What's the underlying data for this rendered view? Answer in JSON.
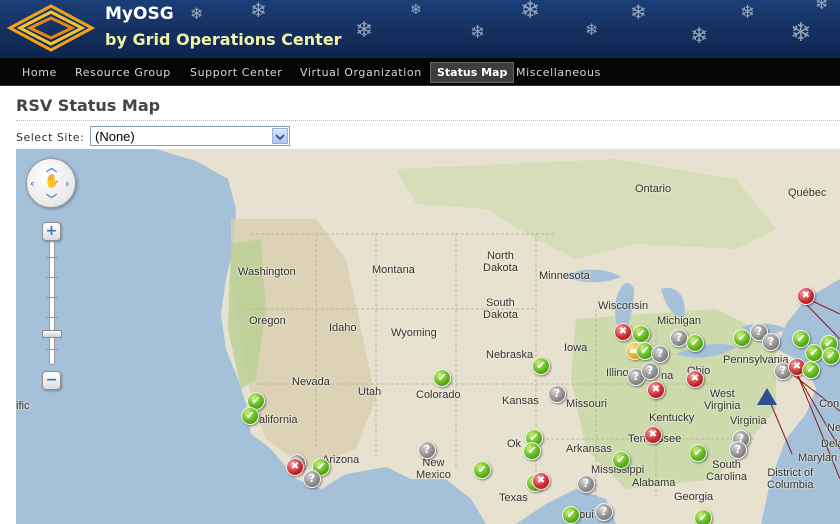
{
  "app": {
    "title": "MyOSG",
    "subtitle": "by Grid Operations Center",
    "logo_icon": "osg-logo-icon"
  },
  "nav": {
    "items": [
      {
        "label": "Home",
        "active": false
      },
      {
        "label": "Resource Group",
        "active": false
      },
      {
        "label": "Support Center",
        "active": false
      },
      {
        "label": "Virtual Organization",
        "active": false
      },
      {
        "label": "Status Map",
        "active": true
      },
      {
        "label": "Miscellaneous",
        "active": false
      }
    ]
  },
  "page": {
    "title": "RSV Status Map",
    "select_label": "Select Site:",
    "select_value": "(None)"
  },
  "map": {
    "controls": {
      "pan_icon": "hand-icon",
      "zoom_in": "+",
      "zoom_out": "−"
    },
    "labels": {
      "ontario": "Ontario",
      "quebec": "Québec",
      "washington": "Washington",
      "montana": "Montana",
      "north_dakota": "North\nDakota",
      "minnesota": "Minnesota",
      "south_dakota": "South\nDakota",
      "wisconsin": "Wisconsin",
      "michigan": "Michigan",
      "oregon": "Oregon",
      "idaho": "Idaho",
      "wyoming": "Wyoming",
      "nebraska": "Nebraska",
      "iowa": "Iowa",
      "pennsylvania": "Pennsylvania",
      "illinois": "Illino",
      "indiana": "na",
      "ohio": "Ohio",
      "nevada": "Nevada",
      "utah": "Utah",
      "colorado": "Colorado",
      "kansas": "Kansas",
      "missouri": "Missouri",
      "west_virginia": "West\nVirginia",
      "kentucky": "Kentucky",
      "virginia": "Virginia",
      "pacific": "ific",
      "california": "alifornia",
      "tennessee": "Tennessee",
      "oklahoma": "Ok",
      "arkansas": "Arkansas",
      "arizona": "Arizona",
      "new_mexico": "New\nMexico",
      "mississippi": "Mississippi",
      "south_carolina": "South\nCarolina",
      "north_carolina": "Ne",
      "delaware": "Dela",
      "maryland": "Marylan",
      "dc": "District of\nColumbia",
      "connecticut": "Con",
      "alabama": "Alabama",
      "georgia": "Georgia",
      "texas": "Texas",
      "louisiana": "Loui"
    },
    "markers": [
      {
        "status": "ok",
        "icon": "check-icon"
      },
      {
        "status": "error",
        "icon": "close-icon"
      },
      {
        "status": "unknown",
        "icon": "question-icon"
      },
      {
        "status": "warning",
        "icon": "minus-icon"
      },
      {
        "status": "downtime",
        "icon": "triangle-icon"
      }
    ],
    "colors": {
      "ok": "#58b11a",
      "error": "#c7262b",
      "unknown": "#8a8a8a",
      "warning": "#e6ad10",
      "downtime": "#2f4f95",
      "water": "#a5c1d9",
      "land": "#e6e2cf"
    }
  }
}
